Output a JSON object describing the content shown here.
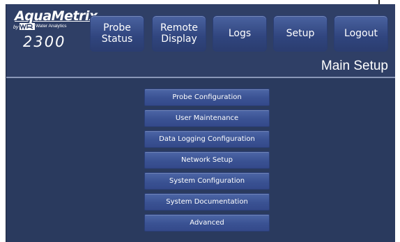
{
  "logo": {
    "brand": "AquaMetrix",
    "by": "by",
    "subtitle": "Water Analytics",
    "model": "2300"
  },
  "nav": [
    {
      "label": "Probe\nStatus"
    },
    {
      "label": "Remote\nDisplay"
    },
    {
      "label": "Logs"
    },
    {
      "label": "Setup"
    },
    {
      "label": "Logout"
    }
  ],
  "page": {
    "title": "Main Setup"
  },
  "menu": [
    {
      "label": "Probe Configuration"
    },
    {
      "label": "User Maintenance"
    },
    {
      "label": "Data Logging Configuration"
    },
    {
      "label": "Network Setup"
    },
    {
      "label": "System Configuration"
    },
    {
      "label": "System Documentation"
    },
    {
      "label": "Advanced"
    }
  ],
  "colors": {
    "header_bg": "#2f3f66",
    "body_bg": "#2a3a5e",
    "button": "#3a5293"
  }
}
